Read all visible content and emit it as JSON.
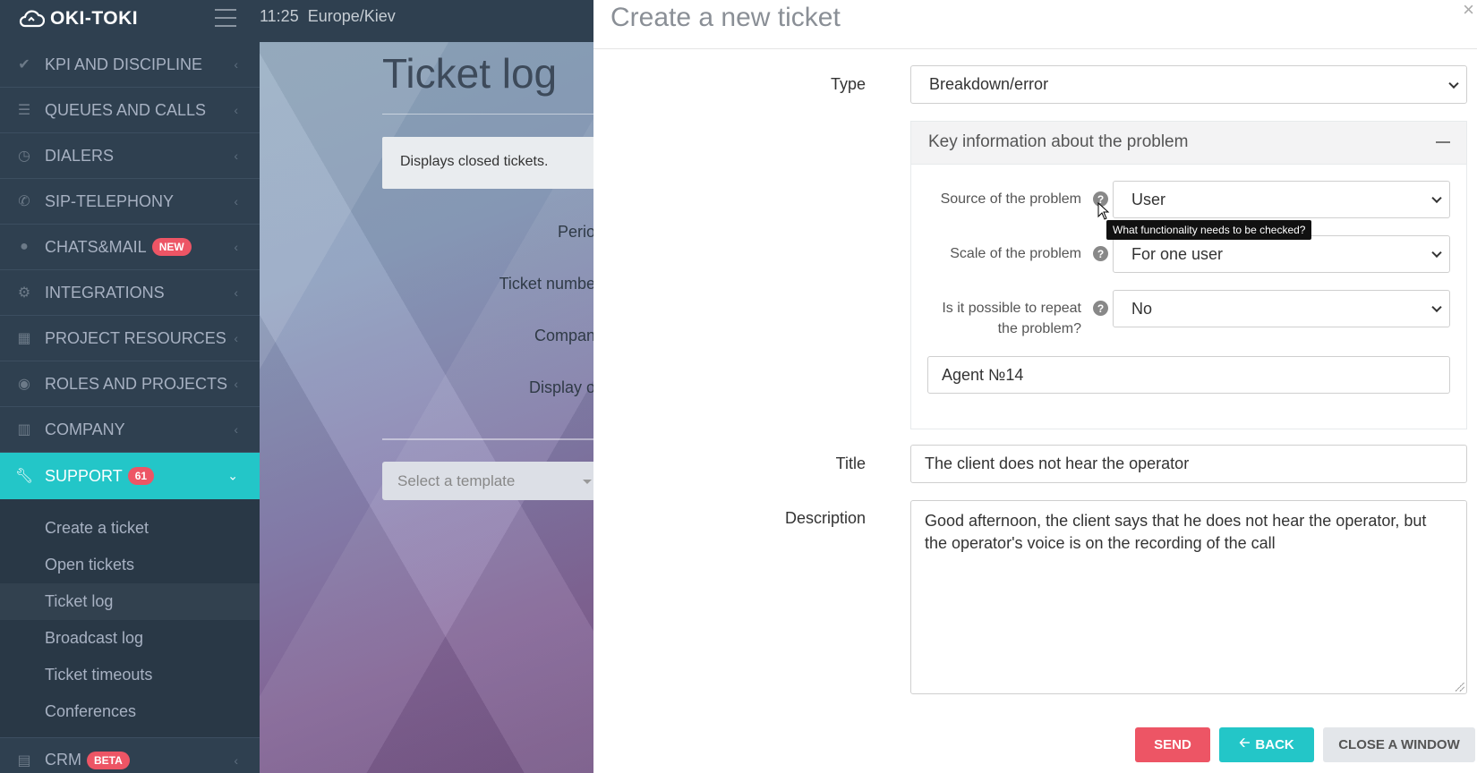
{
  "app": {
    "logo_text": "OKI-TOKI",
    "time": "11:25",
    "timezone": "Europe/Kiev"
  },
  "sidebar": {
    "items": [
      {
        "label": "KPI AND DISCIPLINE",
        "icon": "check-icon"
      },
      {
        "label": "QUEUES AND CALLS",
        "icon": "list-icon"
      },
      {
        "label": "DIALERS",
        "icon": "clock-icon"
      },
      {
        "label": "SIP-TELEPHONY",
        "icon": "phone-icon"
      },
      {
        "label": "CHATS&MAIL",
        "icon": "chat-icon",
        "badge": "NEW"
      },
      {
        "label": "INTEGRATIONS",
        "icon": "gears-icon"
      },
      {
        "label": "PROJECT RESOURCES",
        "icon": "grid-icon"
      },
      {
        "label": "ROLES AND PROJECTS",
        "icon": "toggle-icon"
      },
      {
        "label": "COMPANY",
        "icon": "bar-chart-icon"
      },
      {
        "label": "SUPPORT",
        "icon": "wrench-icon",
        "badge": "61"
      },
      {
        "label": "CRM",
        "icon": "table-icon",
        "badge": "BETA"
      }
    ],
    "support_submenu": [
      "Create a ticket",
      "Open tickets",
      "Ticket log",
      "Broadcast log",
      "Ticket timeouts",
      "Conferences"
    ]
  },
  "background_page": {
    "title": "Ticket log",
    "info": "Displays closed tickets.",
    "labels": [
      "Perio",
      "Ticket numbe",
      "Compan",
      "Display o"
    ],
    "template_placeholder": "Select a template"
  },
  "modal": {
    "title": "Create a new ticket",
    "close_symbol": "×",
    "type_label": "Type",
    "type_value": "Breakdown/error",
    "panel_title": "Key information about the problem",
    "source_label": "Source of the problem",
    "source_value": "User",
    "tooltip": "What functionality needs to be checked?",
    "scale_label": "Scale of the problem",
    "scale_value": "For one user",
    "repeat_label_line1": "Is it possible to repeat",
    "repeat_label_line2": "the problem?",
    "repeat_value": "No",
    "agent_value": "Agent №14",
    "title_label": "Title",
    "title_value": "The client does not hear the operator",
    "description_label": "Description",
    "description_value": "Good afternoon, the client says that he does not hear the operator, but the operator's voice is on the recording of the call",
    "send_label": "SEND",
    "back_label": "BACK",
    "close_label": "CLOSE A WINDOW"
  },
  "colors": {
    "sidebar": "#2f4050",
    "accent": "#23c6c8",
    "danger": "#ed5565"
  }
}
